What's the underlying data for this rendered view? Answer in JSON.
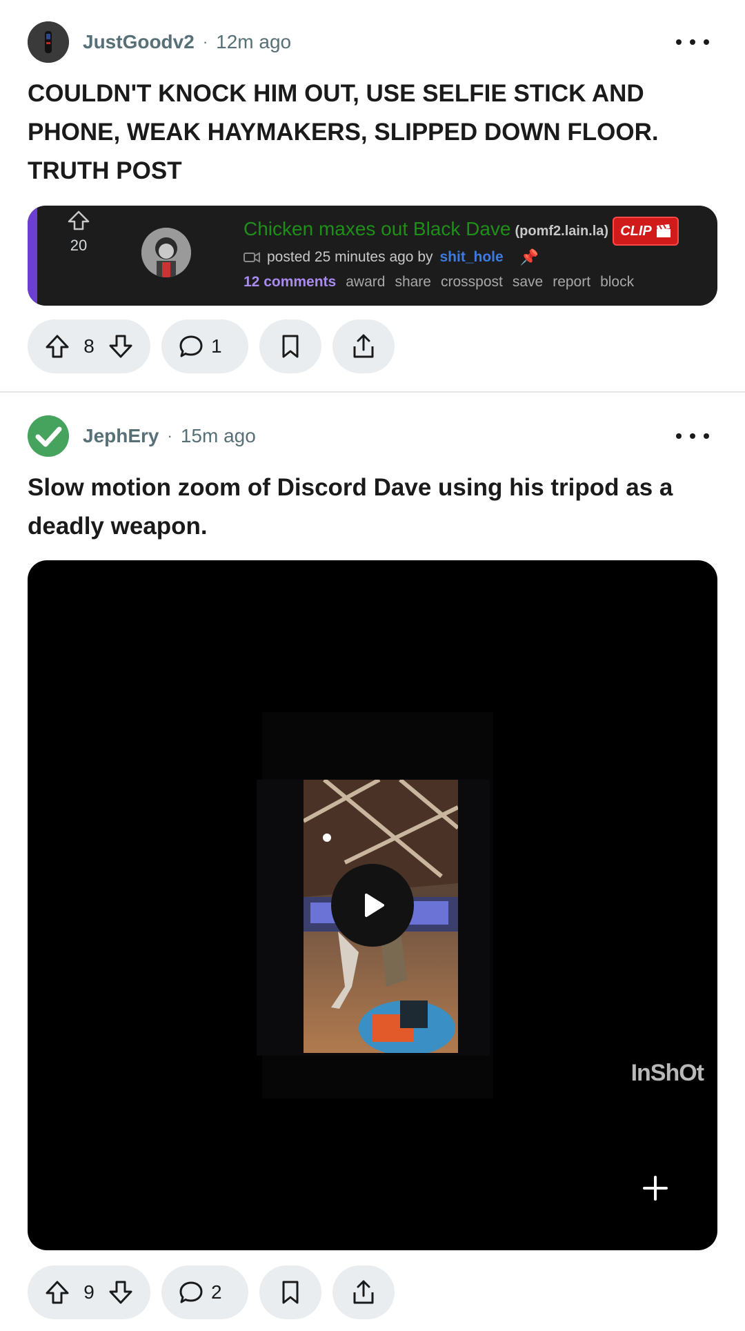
{
  "posts": [
    {
      "author": "JustGoodv2",
      "separator": "·",
      "time": "12m ago",
      "title": "COULDN'T KNOCK HIM OUT, USE SELFIE STICK AND PHONE, WEAK HAYMAKERS, SLIPPED DOWN FLOOR. TRUTH POST",
      "embed": {
        "score": "20",
        "title": "Chicken maxes out Black Dave",
        "domain": "(pomf2.lain.la)",
        "flair": "CLIP",
        "posted": "posted 25 minutes ago by",
        "user": "shit_hole",
        "comments": "12 comments",
        "links": [
          "award",
          "share",
          "crosspost",
          "save",
          "report",
          "block"
        ]
      },
      "votes": "8",
      "comment_count": "1"
    },
    {
      "author": "JephEry",
      "separator": "·",
      "time": "15m ago",
      "title": "Slow motion zoom of Discord Dave using his tripod as a deadly weapon.",
      "video": {
        "watermark": "InShOt"
      },
      "votes": "9",
      "comment_count": "2"
    }
  ],
  "colors": {
    "accent_green": "#46a35e",
    "pill_bg": "#eaedef",
    "embed_bg": "#1c1c1d",
    "embed_title": "#1f8f1a",
    "embed_bar": "#6b3fd1"
  },
  "icons": [
    "more-icon",
    "upvote-icon",
    "downvote-icon",
    "comment-icon",
    "bookmark-icon",
    "share-icon",
    "play-icon",
    "expand-plus-icon",
    "checkmark-icon",
    "camera-icon",
    "pin-icon"
  ]
}
